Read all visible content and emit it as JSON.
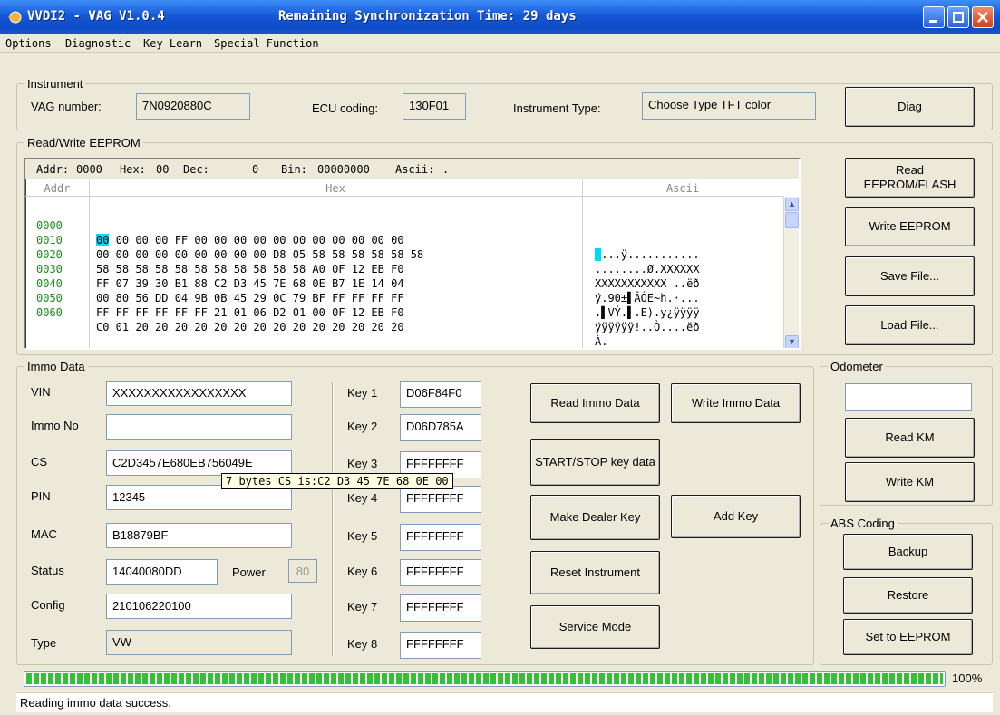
{
  "window": {
    "title": "VVDI2 - VAG V1.0.4",
    "sync_text": "Remaining Synchronization Time: 29 days"
  },
  "menu": [
    "Options",
    "Diagnostic",
    "Key Learn",
    "Special Function"
  ],
  "instrument": {
    "group_label": "Instrument",
    "vag_label": "VAG number:",
    "vag_value": "7N0920880C",
    "ecu_label": "ECU coding:",
    "ecu_value": "130F01",
    "type_label": "Instrument Type:",
    "type_value": "Choose Type TFT color",
    "diag_button": "Diag"
  },
  "eeprom": {
    "group_label": "Read/Write EEPROM",
    "info": {
      "addr_label": "Addr:",
      "addr_value": "0000",
      "hex_label": "Hex:",
      "hex_value": "00",
      "dec_label": "Dec:",
      "dec_value": "0",
      "bin_label": "Bin:",
      "bin_value": "00000000",
      "ascii_label": "Ascii:",
      "ascii_value": "."
    },
    "col_addr": "Addr",
    "col_hex": "Hex",
    "col_ascii": "Ascii",
    "rows": [
      {
        "addr": "0000",
        "first": "00",
        "hex": "00 00 00 FF 00 00 00 00 00 00 00 00 00 00 00",
        "ascii": "...ÿ..........."
      },
      {
        "addr": "0010",
        "first": "",
        "hex": "00 00 00 00 00 00 00 00 00 D8 05 58 58 58 58 58 58",
        "ascii": "........Ø.XXXXXX"
      },
      {
        "addr": "0020",
        "first": "",
        "hex": "58 58 58 58 58 58 58 58 58 58 58 A0 0F 12 EB F0",
        "ascii": "XXXXXXXXXXX ..ëð"
      },
      {
        "addr": "0030",
        "first": "",
        "hex": "FF 07 39 30 B1 88 C2 D3 45 7E 68 0E B7 1E 14 04",
        "ascii": "ÿ.90±▌ÂÓE~h.·..."
      },
      {
        "addr": "0040",
        "first": "",
        "hex": "00 80 56 DD 04 9B 0B 45 29 0C 79 BF FF FF FF FF",
        "ascii": ".▌VÝ.▌.E).y¿ÿÿÿÿ"
      },
      {
        "addr": "0050",
        "first": "",
        "hex": "FF FF FF FF FF FF 21 01 06 D2 01 00 0F 12 EB F0",
        "ascii": "ÿÿÿÿÿÿ!..Ò....ëð"
      },
      {
        "addr": "0060",
        "first": "",
        "hex": "C0 01 20 20 20 20 20 20 20 20 20 20 20 20 20 20",
        "ascii": "À."
      }
    ],
    "buttons": {
      "read": "Read EEPROM/FLASH",
      "write": "Write EEPROM",
      "save": "Save File...",
      "load": "Load File..."
    }
  },
  "immo": {
    "group_label": "Immo Data",
    "vin_label": "VIN",
    "vin_value": "XXXXXXXXXXXXXXXXX",
    "immo_label": "Immo No",
    "immo_value": "",
    "cs_label": "CS",
    "cs_value": "C2D3457E680EB756049E",
    "pin_label": "PIN",
    "pin_value": "12345",
    "mac_label": "MAC",
    "mac_value": "B18879BF",
    "status_label": "Status",
    "status_value": "14040080DD",
    "power_label": "Power",
    "power_value": "80",
    "config_label": "Config",
    "config_value": "210106220100",
    "type_label": "Type",
    "type_value": "VW",
    "keys": [
      {
        "label": "Key 1",
        "value": "D06F84F0"
      },
      {
        "label": "Key 2",
        "value": "D06D785A"
      },
      {
        "label": "Key 3",
        "value": "FFFFFFFF"
      },
      {
        "label": "Key 4",
        "value": "FFFFFFFF"
      },
      {
        "label": "Key 5",
        "value": "FFFFFFFF"
      },
      {
        "label": "Key 6",
        "value": "FFFFFFFF"
      },
      {
        "label": "Key 7",
        "value": "FFFFFFFF"
      },
      {
        "label": "Key 8",
        "value": "FFFFFFFF"
      }
    ],
    "buttons": {
      "read": "Read Immo Data",
      "write": "Write Immo Data",
      "startstop": "START/STOP key data",
      "dealer": "Make Dealer Key",
      "addkey": "Add Key",
      "reset": "Reset Instrument",
      "service": "Service Mode"
    },
    "tooltip": "7 bytes CS is:C2 D3 45 7E 68 0E 00"
  },
  "odometer": {
    "group_label": "Odometer",
    "value": "",
    "read": "Read KM",
    "write": "Write KM"
  },
  "abs": {
    "group_label": "ABS Coding",
    "backup": "Backup",
    "restore": "Restore",
    "set": "Set to EEPROM"
  },
  "progress": {
    "value": 100,
    "label": "100%"
  },
  "status_text": "Reading immo data success.",
  "colors": {
    "title_bar": "#0d4cc7",
    "progress": "#35c035",
    "addr": "#1a8a1a",
    "selection": "#00d8ff"
  }
}
